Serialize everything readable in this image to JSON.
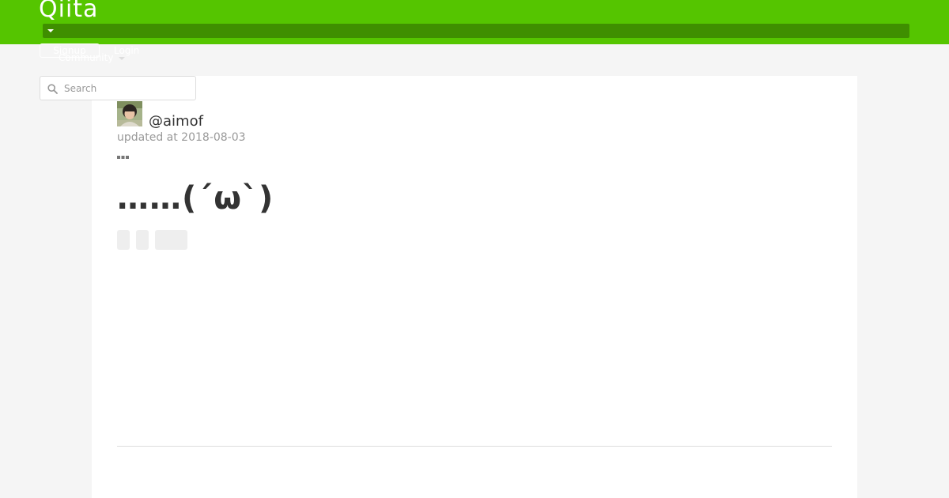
{
  "header": {
    "logo": "Qiita",
    "signup_label": "Signup",
    "login_label": "Login",
    "community_label": "Community",
    "brand_color": "#55c500"
  },
  "search": {
    "placeholder": "Search"
  },
  "article": {
    "author": "@aimof",
    "updated": "updated at 2018-08-03",
    "title": "……(´ω`)",
    "tags": [
      "",
      "",
      ""
    ]
  }
}
